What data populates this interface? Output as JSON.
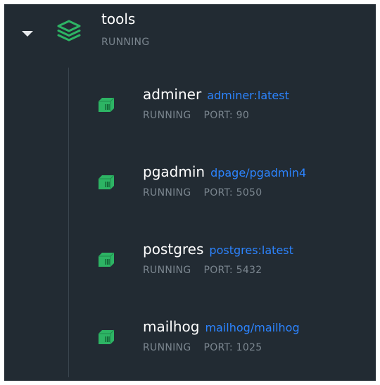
{
  "stack": {
    "name": "tools",
    "status": "RUNNING",
    "accent": "#2db464"
  },
  "containers": [
    {
      "name": "adminer",
      "image": "adminer:latest",
      "status": "RUNNING",
      "port": "PORT: 90"
    },
    {
      "name": "pgadmin",
      "image": "dpage/pgadmin4",
      "status": "RUNNING",
      "port": "PORT: 5050"
    },
    {
      "name": "postgres",
      "image": "postgres:latest",
      "status": "RUNNING",
      "port": "PORT: 5432"
    },
    {
      "name": "mailhog",
      "image": "mailhog/mailhog",
      "status": "RUNNING",
      "port": "PORT: 1025"
    }
  ],
  "colors": {
    "background": "#222b33",
    "link": "#2c84ff",
    "muted": "#7b868f",
    "container_icon": "#2db464"
  }
}
